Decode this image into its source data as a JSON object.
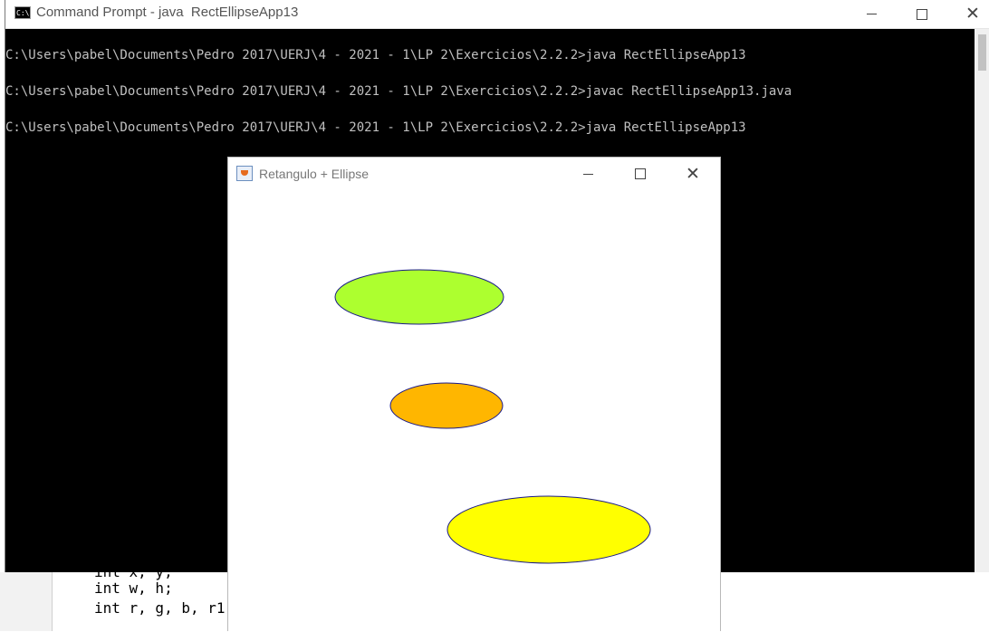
{
  "cmd": {
    "title": "Command Prompt - java  RectEllipseApp13",
    "icon_label": "C:\\",
    "lines": [
      "C:\\Users\\pabel\\Documents\\Pedro 2017\\UERJ\\4 - 2021 - 1\\LP 2\\Exercicios\\2.2.2>java RectEllipseApp13",
      "C:\\Users\\pabel\\Documents\\Pedro 2017\\UERJ\\4 - 2021 - 1\\LP 2\\Exercicios\\2.2.2>javac RectEllipseApp13.java",
      "C:\\Users\\pabel\\Documents\\Pedro 2017\\UERJ\\4 - 2021 - 1\\LP 2\\Exercicios\\2.2.2>java RectEllipseApp13"
    ],
    "background": "#000000",
    "text_color": "#c0c0c0"
  },
  "editor": {
    "lines": [
      "int x, y;",
      "int w, h;",
      "int r, g, b, r1"
    ]
  },
  "java_window": {
    "title": "Retangulo + Ellipse",
    "ellipses": [
      {
        "name": "green-ellipse",
        "fill": "#adff2f",
        "stroke": "#1a1a8a"
      },
      {
        "name": "orange-ellipse",
        "fill": "#ffb600",
        "stroke": "#1a1a8a"
      },
      {
        "name": "yellow-ellipse",
        "fill": "#ffff00",
        "stroke": "#1a1a8a"
      }
    ]
  },
  "icons": {
    "minimize": "minimize-icon",
    "maximize": "maximize-icon",
    "close": "close-icon"
  }
}
